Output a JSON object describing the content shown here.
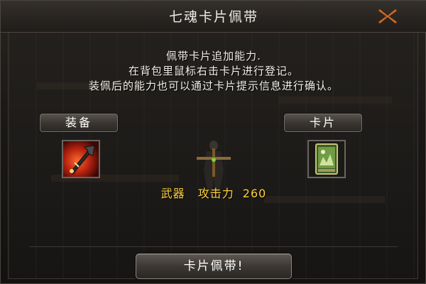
{
  "window": {
    "title": "七魂卡片佩带"
  },
  "description": {
    "line1": "佩带卡片追加能力.",
    "line2": "在背包里鼠标右击卡片进行登记。",
    "line3": "装佩后的能力也可以通过卡片提示信息进行确认。"
  },
  "panels": {
    "equipment_label": "装备",
    "card_label": "卡片"
  },
  "stat": {
    "slot_type": "武器",
    "attribute": "攻击力",
    "value": "260"
  },
  "actions": {
    "confirm_label": "卡片佩带!"
  },
  "icons": {
    "close": "close-x-icon",
    "equipment": "weapon-item-icon",
    "card": "card-item-icon"
  },
  "colors": {
    "close_accent": "#e0772a",
    "stat_text": "#ffd23a",
    "button_text": "#ffffff"
  }
}
